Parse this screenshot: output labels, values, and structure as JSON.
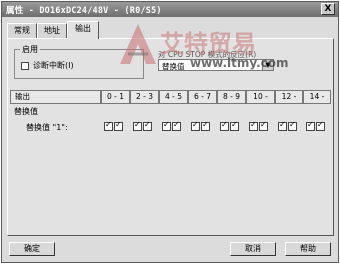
{
  "window": {
    "title": "属性 - DO16xDC24/48V - (R0/S5)",
    "close_label": "X"
  },
  "tabs": [
    {
      "label": "常规"
    },
    {
      "label": "地址"
    },
    {
      "label": "输出"
    }
  ],
  "enable_group": {
    "label": "启用",
    "diagnostic_interrupt": {
      "label": "诊断中断(I)",
      "checked": false
    }
  },
  "cpu_stop": {
    "label": "对 CPU STOP 模式的反应(R)",
    "value": "替换值",
    "options_visible": [
      "替换值"
    ]
  },
  "output_table": {
    "headers": [
      "输出",
      "0 - 1",
      "2 - 3",
      "4 - 5",
      "6 - 7",
      "8 - 9",
      "10 -",
      "12 -",
      "14 -"
    ],
    "section_label": "替换值",
    "row_label": "替换值 \"1\":",
    "substitute_values": [
      [
        true,
        true
      ],
      [
        true,
        true
      ],
      [
        true,
        true
      ],
      [
        true,
        true
      ],
      [
        true,
        true
      ],
      [
        true,
        true
      ],
      [
        true,
        true
      ],
      [
        true,
        true
      ]
    ]
  },
  "buttons": {
    "ok": "确定",
    "cancel": "取消",
    "help": "帮助"
  },
  "watermark": {
    "brand": "艾特贸易",
    "url": "www.itmy.com"
  },
  "colors": {
    "title_bar": "#7a7a7a",
    "window_bg": "#dcdcdc",
    "watermark_red": "#c06060"
  }
}
